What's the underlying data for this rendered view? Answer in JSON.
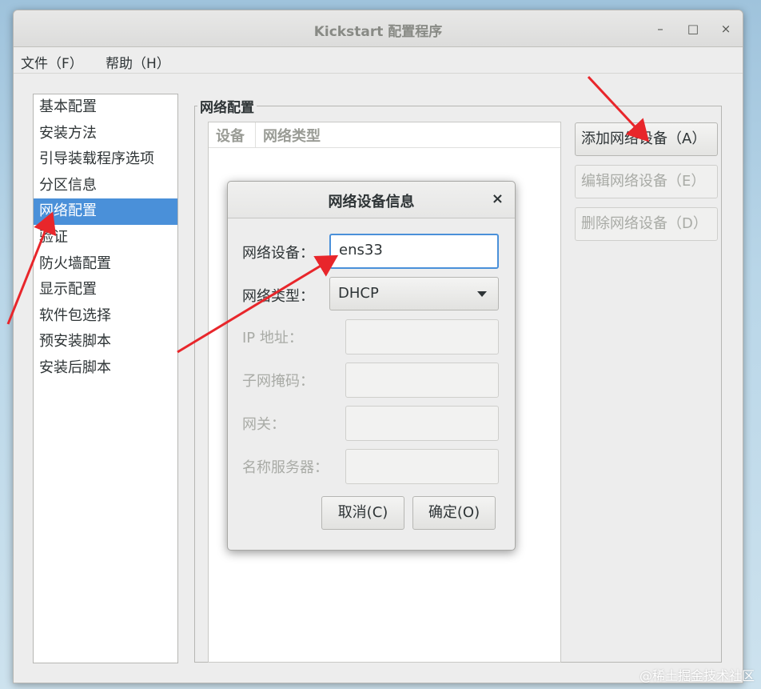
{
  "window": {
    "title": "Kickstart 配置程序"
  },
  "window_controls": {
    "minimize": "–",
    "maximize": "□",
    "close": "×"
  },
  "menu": [
    "文件（F）",
    "帮助（H）"
  ],
  "sidebar": {
    "items": [
      "基本配置",
      "安装方法",
      "引导装载程序选项",
      "分区信息",
      "网络配置",
      "验证",
      "防火墙配置",
      "显示配置",
      "软件包选择",
      "预安装脚本",
      "安装后脚本"
    ],
    "selected": "网络配置"
  },
  "network_panel": {
    "frame_title": "网络配置",
    "table_headers": [
      "设备",
      "网络类型"
    ],
    "buttons": {
      "add": "添加网络设备（A）",
      "edit": "编辑网络设备（E）",
      "delete": "删除网络设备（D）"
    }
  },
  "dialog": {
    "title": "网络设备信息",
    "close": "×",
    "labels": {
      "device": "网络设备：",
      "type": "网络类型：",
      "ip": "IP 地址：",
      "netmask": "子网掩码：",
      "gateway": "网关：",
      "nameserver": "名称服务器："
    },
    "values": {
      "device": "ens33",
      "type": "DHCP",
      "ip": "",
      "netmask": "",
      "gateway": "",
      "nameserver": ""
    },
    "buttons": {
      "cancel": "取消(C)",
      "ok": "确定(O)"
    }
  },
  "watermark": "@稀土掘金技术社区",
  "colors": {
    "selection": "#4a90d9",
    "focus_border": "#4a90d9",
    "annotation_arrow": "#e8262b"
  }
}
